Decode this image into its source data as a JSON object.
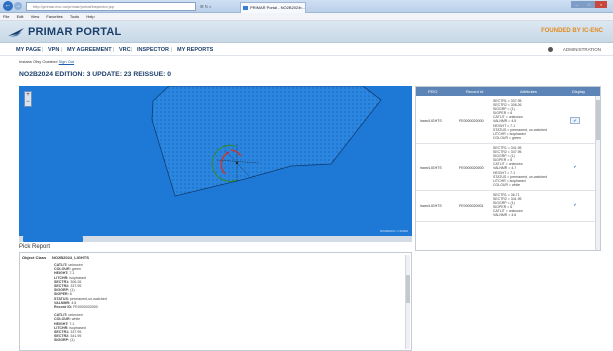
{
  "browser": {
    "address": "http://primar.ecc.no/primar/portal/inspector.jsp",
    "address_tools": "☰ ↻ ×",
    "tab_title": "PRIMAR Portal - NO2B2024 ...",
    "tab_close": "×",
    "menu": [
      "File",
      "Edit",
      "View",
      "Favorites",
      "Tools",
      "Help"
    ],
    "back_glyph": "←",
    "fwd_glyph": "→",
    "win_min": "–",
    "win_max": "□",
    "win_close": "×"
  },
  "header": {
    "logo": "PRIMAR PORTAL",
    "brand_right": "FOUNDED BY IC-ENC",
    "accent": "#e48a1e"
  },
  "nav": {
    "items": [
      "MY PAGE",
      "VPN",
      "MY AGREEMENT",
      "VRC",
      "INSPECTOR",
      "MY REPORTS"
    ],
    "separator": "|",
    "admin": "ADMINISTRATION"
  },
  "user": {
    "label": "Instans Ofsy Oostend",
    "link": "Sign Out"
  },
  "page": {
    "title": "NO2B2024 EDITION: 3 UPDATE: 23 REISSUE: 0"
  },
  "map": {
    "zoom_in": "+",
    "zoom_out": "−",
    "credit": "NO2B2024 / 1:22000",
    "water_color": "#1e79d6"
  },
  "pick_report": {
    "label": "Pick Report",
    "object_key": "Object Class",
    "object_val": "NO2B2024_LIGHTS",
    "groups": [
      [
        [
          "CATLIT",
          "unknown"
        ],
        [
          "COLOUR",
          "green"
        ],
        [
          "HEIGHT",
          "7.1"
        ],
        [
          "LITCHR",
          "isophased"
        ],
        [
          "SECTR1",
          "306.26"
        ],
        [
          "SECTR2",
          "337.95"
        ],
        [
          "SIGGRP",
          "(1)"
        ],
        [
          "SIGPER",
          "6"
        ],
        [
          "STATUS",
          "permanent,un-watched"
        ],
        [
          "VALNMR",
          "4.5"
        ],
        [
          "Record ID",
          "FE0000020000"
        ]
      ],
      [
        [
          "CATLIT",
          "unknown"
        ],
        [
          "COLOUR",
          "white"
        ],
        [
          "HEIGHT",
          "7.1"
        ],
        [
          "LITCHR",
          "isophased"
        ],
        [
          "SECTR1",
          "337.95"
        ],
        [
          "SECTR2",
          "341.95"
        ],
        [
          "SIGGRP",
          "(1)"
        ]
      ]
    ]
  },
  "table": {
    "headers": [
      "FEIO",
      "Record Id",
      "Attributes",
      "Display"
    ],
    "rows": [
      {
        "type": "lnam/LIGHTS",
        "id": "FE0000020000",
        "attrs": [
          "SECTR1 = 337.95",
          "SECTR2 = 306.26",
          "SIGGRP = (1)",
          "SIGPER = 6",
          "CATLIT = unknown",
          "VALNMR = 4.5",
          "HEIGHT = 7.1",
          "STATUS = permanent, un-watched",
          "LITCHR = isophased",
          "COLOUR = green"
        ],
        "action": "✔"
      },
      {
        "type": "lnam/LIGHTS",
        "id": "FE0000020000",
        "attrs": [
          "SECTR1 = 341.95",
          "SECTR2 = 337.95",
          "SIGGRP = (1)",
          "SIGPER = 6",
          "CATLIT = unknown",
          "VALNMR = 4.7",
          "HEIGHT = 7.1",
          "STATUS = permanent, un-watched",
          "LITCHR = isophased",
          "COLOUR = white"
        ],
        "action": "✔"
      },
      {
        "type": "lnam/LIGHTS",
        "id": "FE0000020001",
        "attrs": [
          "SECTR1 = 36.71",
          "SECTR2 = 341.95",
          "SIGGRP = (1)",
          "SIGPER = 6",
          "CATLIT = unknown",
          "VALNMR = 4.6"
        ],
        "action": "✔"
      }
    ]
  }
}
